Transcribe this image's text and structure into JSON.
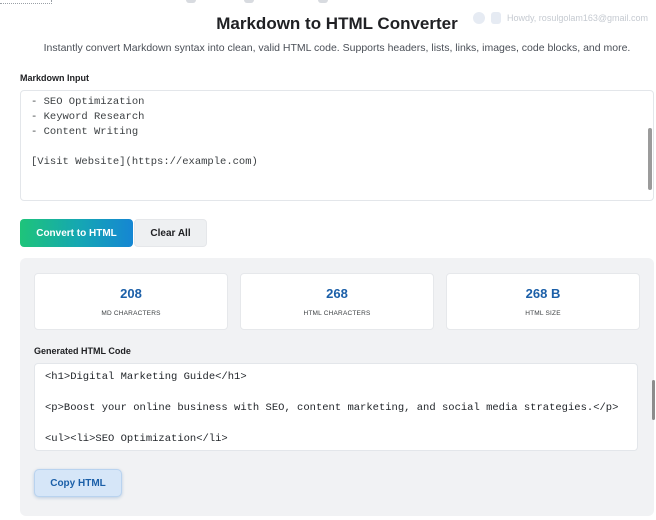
{
  "header": {
    "title": "Markdown to HTML Converter",
    "subtitle": "Instantly convert Markdown syntax into clean, valid HTML code. Supports headers, lists, links, images, code blocks, and more.",
    "admin_greeting": "Howdy, rosulgolam163@gmail.com"
  },
  "input": {
    "label": "Markdown Input",
    "value": "- SEO Optimization\n- Keyword Research\n- Content Writing\n\n[Visit Website](https://example.com)"
  },
  "buttons": {
    "convert_label": "Convert to HTML",
    "clear_label": "Clear All",
    "copy_label": "Copy HTML"
  },
  "stats": [
    {
      "value": "208",
      "label": "MD CHARACTERS"
    },
    {
      "value": "268",
      "label": "HTML CHARACTERS"
    },
    {
      "value": "268 B",
      "label": "HTML SIZE"
    }
  ],
  "output": {
    "label": "Generated HTML Code",
    "value": "<h1>Digital Marketing Guide</h1>\n\n<p>Boost your online business with SEO, content marketing, and social media strategies.</p>\n\n<ul><li>SEO Optimization</li>"
  },
  "colors": {
    "accent_blue": "#1b5fa8",
    "convert_gradient_start": "#1ec47a",
    "convert_gradient_end": "#1586d3",
    "panel_bg": "#f1f2f4"
  }
}
